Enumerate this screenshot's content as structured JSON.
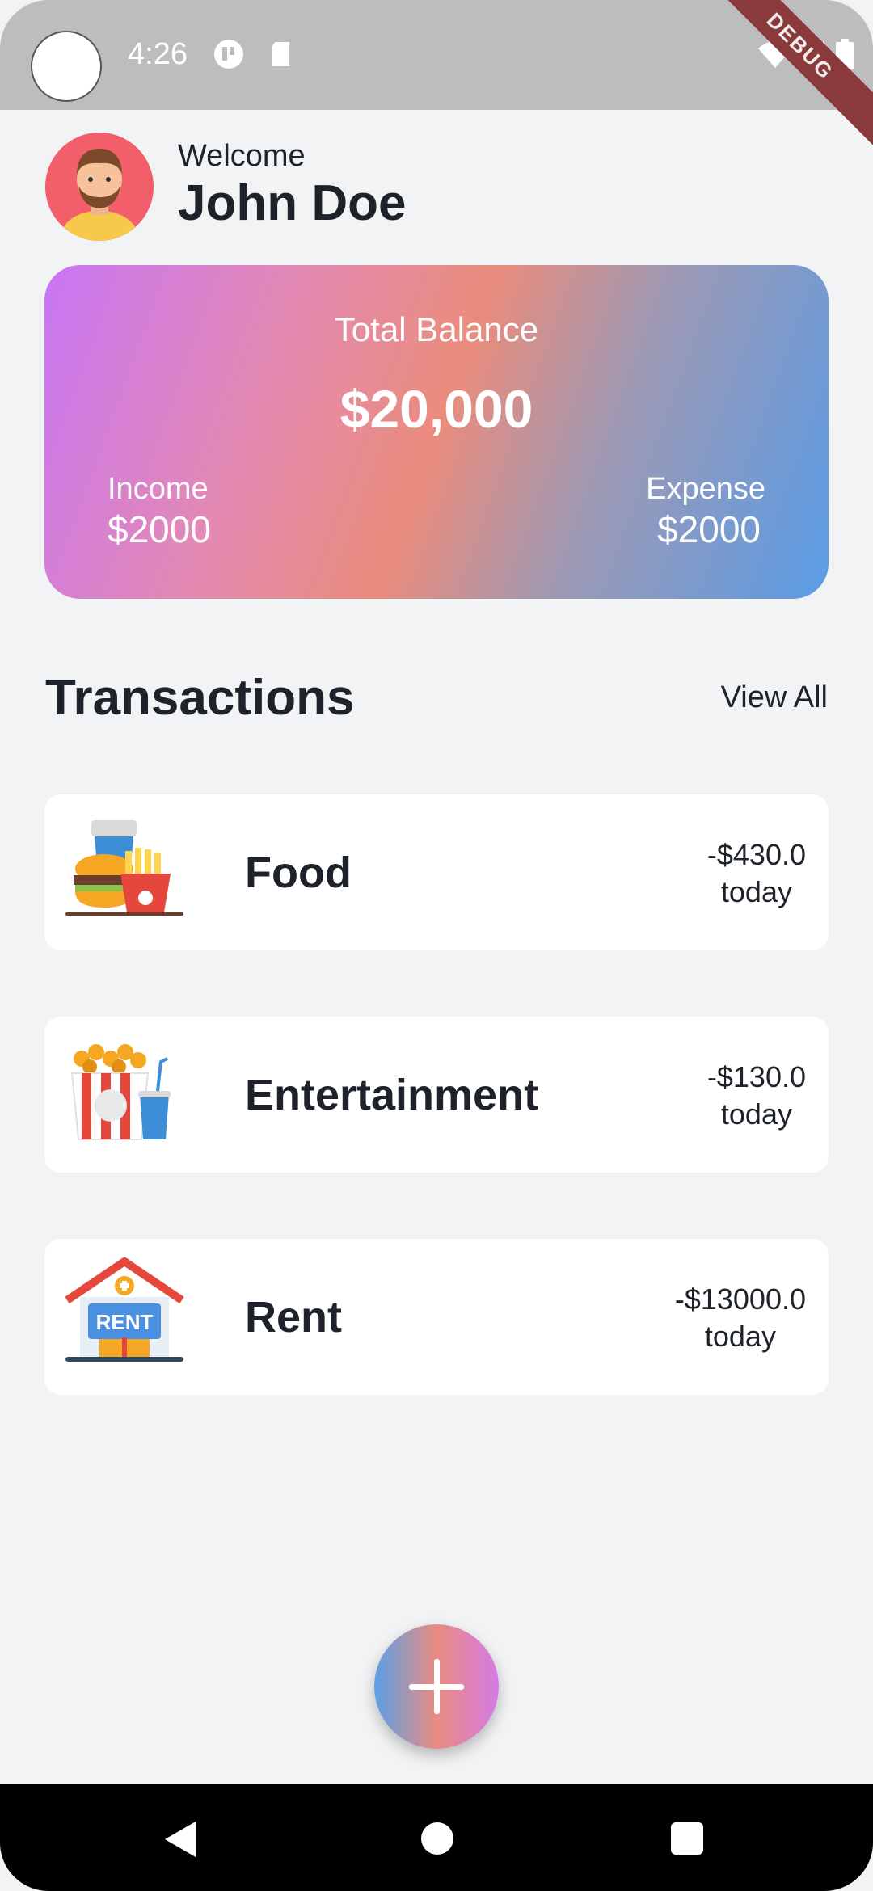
{
  "status_bar": {
    "time": "4:26",
    "debug_label": "DEBUG"
  },
  "header": {
    "welcome": "Welcome",
    "user_name": "John Doe"
  },
  "balance_card": {
    "total_label": "Total Balance",
    "total_amount": "$20,000",
    "income_label": "Income",
    "income_value": "$2000",
    "expense_label": "Expense",
    "expense_value": "$2000"
  },
  "transactions": {
    "title": "Transactions",
    "view_all": "View All",
    "items": [
      {
        "name": "Food",
        "amount": "-$430.0",
        "when": "today",
        "icon": "food-icon"
      },
      {
        "name": "Entertainment",
        "amount": "-$130.0",
        "when": "today",
        "icon": "popcorn-icon"
      },
      {
        "name": "Rent",
        "amount": "-$13000.0",
        "when": "today",
        "icon": "rent-house-icon",
        "icon_text": "RENT"
      }
    ]
  },
  "fab": {
    "icon": "plus-icon"
  },
  "colors": {
    "background": "#f2f3f5",
    "gradient_start": "#c875f5",
    "gradient_mid": "#ea8c7c",
    "gradient_end": "#5a9ce6"
  }
}
